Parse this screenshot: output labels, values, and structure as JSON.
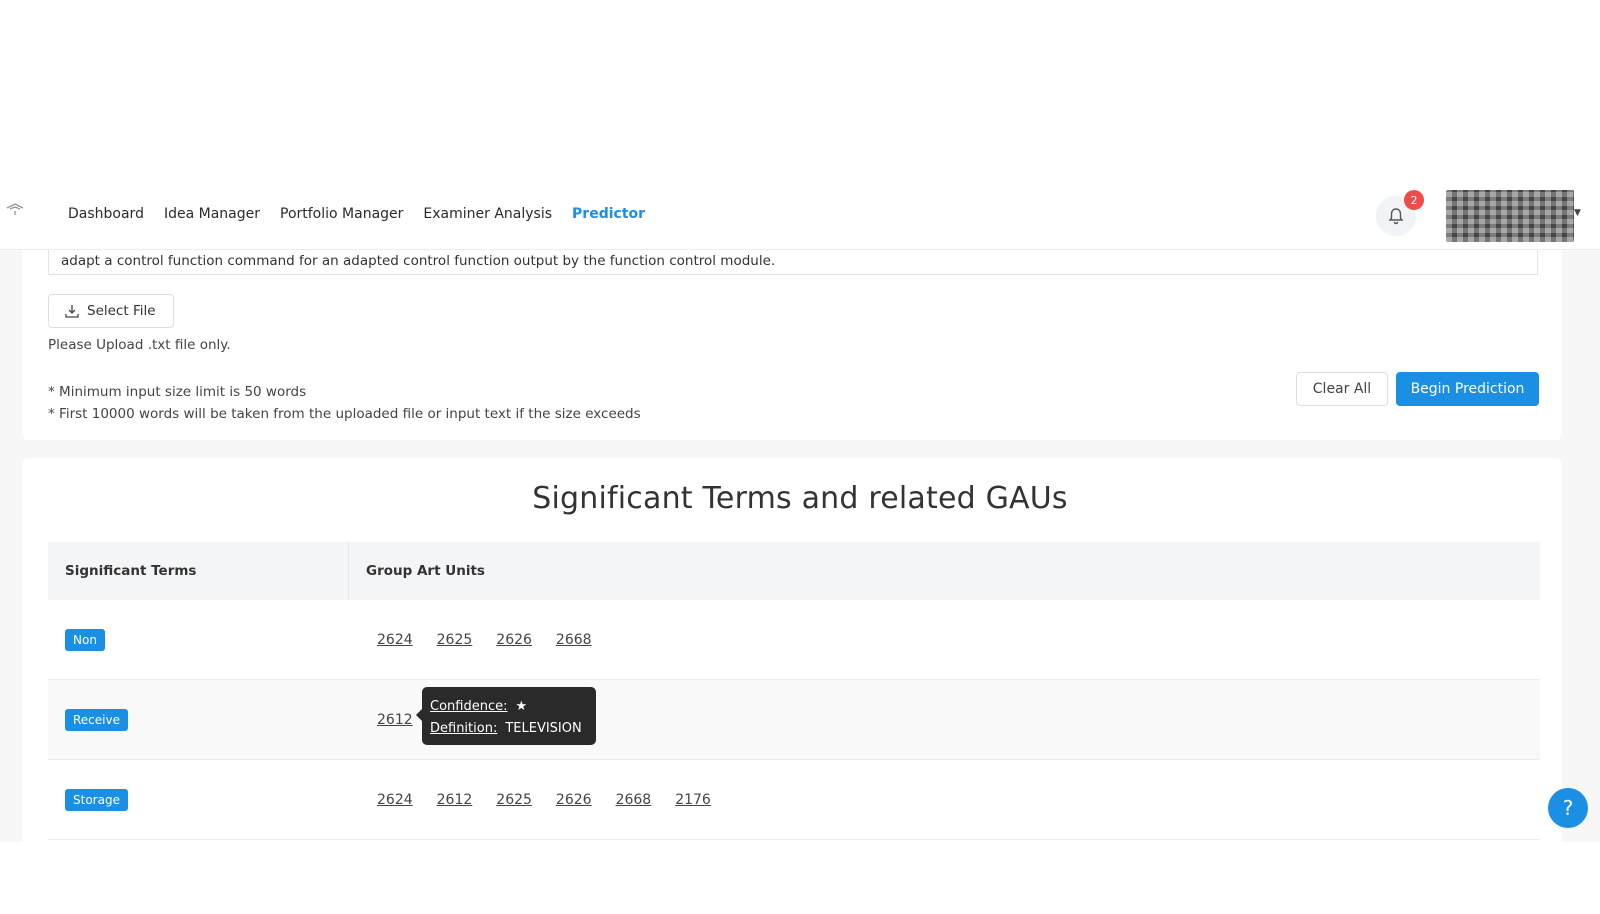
{
  "header": {
    "nav": [
      {
        "label": "Dashboard",
        "active": false
      },
      {
        "label": "Idea Manager",
        "active": false
      },
      {
        "label": "Portfolio Manager",
        "active": false
      },
      {
        "label": "Examiner Analysis",
        "active": false
      },
      {
        "label": "Predictor",
        "active": true
      }
    ],
    "notification_count": "2",
    "icons": {
      "logo": "logo-icon",
      "bell": "bell-icon",
      "avatar": "avatar"
    }
  },
  "input": {
    "description_tail": "adapt a control function command for an adapted control function output by the function control module.",
    "select_file_label": "Select File",
    "upload_hint": "Please Upload .txt file only.",
    "note_min": "* Minimum input size limit is 50 words",
    "note_max": "* First 10000 words will be taken from the uploaded file or input text if the size exceeds",
    "clear_label": "Clear All",
    "begin_label": "Begin Prediction"
  },
  "results": {
    "title": "Significant Terms and related GAUs",
    "col_terms": "Significant Terms",
    "col_gaus": "Group Art Units",
    "rows": [
      {
        "term": "Non",
        "gaus": [
          "2624",
          "2625",
          "2626",
          "2668"
        ]
      },
      {
        "term": "Receive",
        "gaus": [
          "2612"
        ]
      },
      {
        "term": "Storage",
        "gaus": [
          "2624",
          "2612",
          "2625",
          "2626",
          "2668",
          "2176"
        ]
      }
    ]
  },
  "tooltip": {
    "confidence_label": "Confidence:",
    "confidence_stars": 1,
    "definition_label": "Definition:",
    "definition_value": "TELEVISION"
  },
  "help": {
    "label": "?"
  },
  "colors": {
    "accent": "#1a8fe3",
    "badge": "#ef4b4b",
    "tooltip_bg": "#2a2a2a"
  }
}
